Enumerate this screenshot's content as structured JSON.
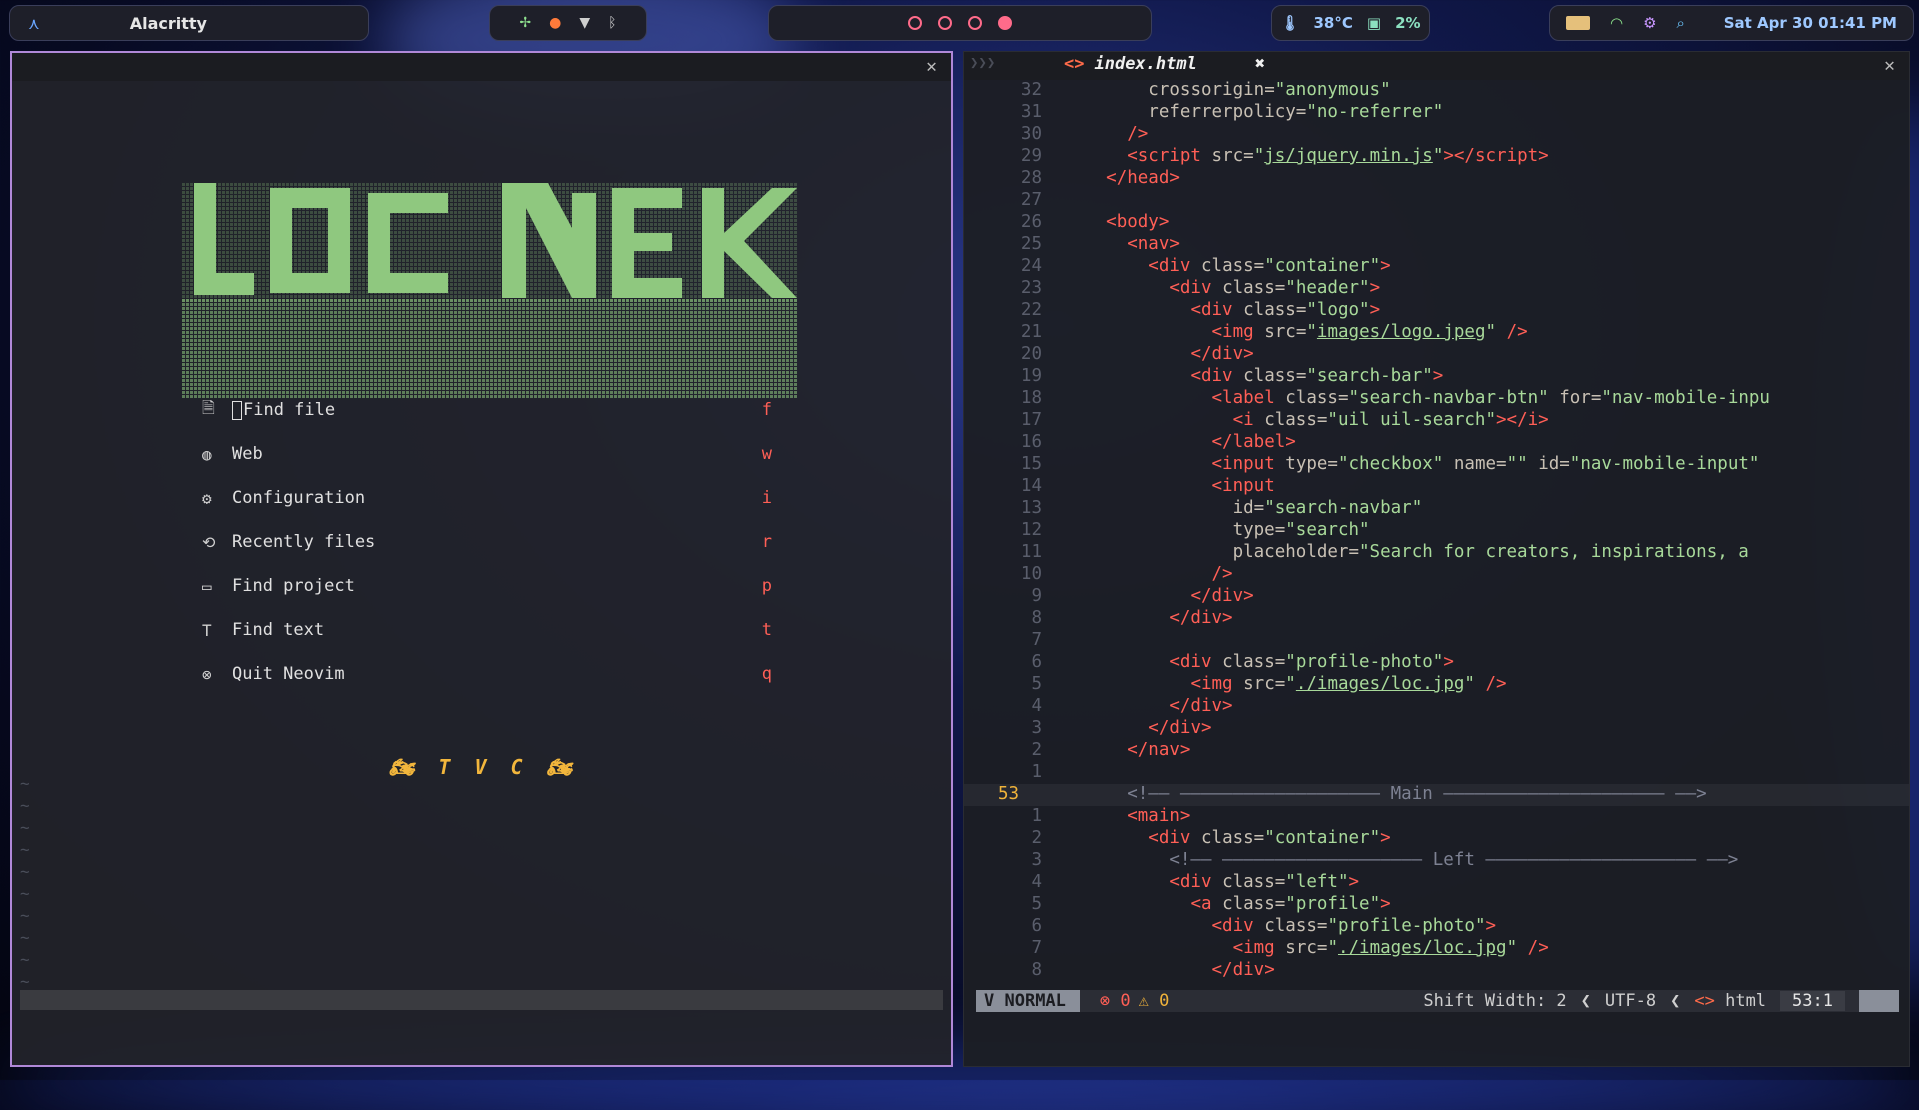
{
  "topbar": {
    "title": "Alacritty",
    "arch_icon": "arch-icon",
    "tray_icons": [
      "fan-icon",
      "firefox-icon",
      "shield-icon",
      "bluetooth-icon"
    ],
    "workspaces": 4,
    "active_workspace": 4,
    "temp": "38°C",
    "cpu": "2%",
    "datetime": "Sat Apr 30 01:41 PM"
  },
  "dashboard": {
    "logo": "LOC NEK",
    "menu": [
      {
        "icon": "file-search-icon",
        "glyph": "🗎",
        "label": "Find file",
        "key": "f"
      },
      {
        "icon": "globe-icon",
        "glyph": "🌐",
        "label": "Web",
        "key": "w"
      },
      {
        "icon": "gear-icon",
        "glyph": "⚙",
        "label": "Configuration",
        "key": "i"
      },
      {
        "icon": "history-icon",
        "glyph": "⟲",
        "label": "Recently files",
        "key": "r"
      },
      {
        "icon": "folder-icon",
        "glyph": "🗀",
        "label": "Find project",
        "key": "p"
      },
      {
        "icon": "text-icon",
        "glyph": "T",
        "label": "Find text",
        "key": "t"
      },
      {
        "icon": "quit-icon",
        "glyph": "⊗",
        "label": "Quit Neovim",
        "key": "q"
      }
    ],
    "signature": "T V C"
  },
  "editor": {
    "filename": "index.html",
    "mode": "NORMAL",
    "errors": "0",
    "warnings": "0",
    "shift_width": "Shift Width: 2",
    "encoding": "UTF-8",
    "filetype": "html",
    "position": "53:1"
  }
}
